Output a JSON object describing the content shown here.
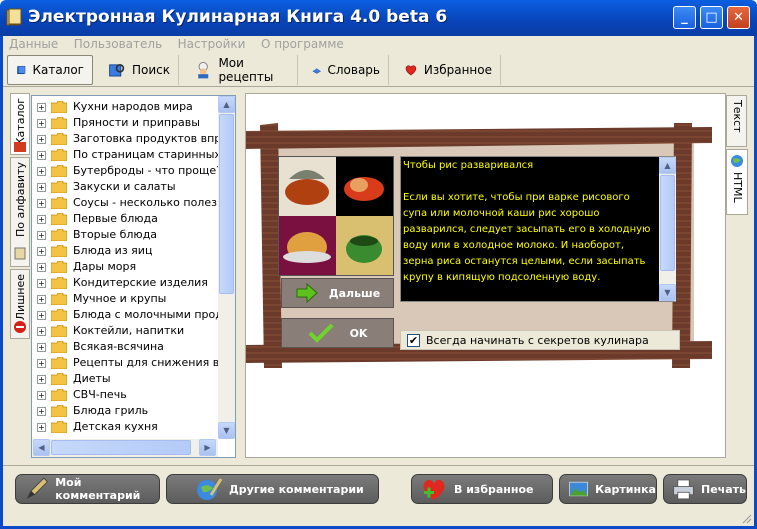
{
  "window": {
    "title": "Электронная Кулинарная Книга 4.0 beta 6",
    "minimize": "_",
    "maximize": "□",
    "close": "✕"
  },
  "menu": [
    "Данные",
    "Пользователь",
    "Настройки",
    "О программе"
  ],
  "toolbar": {
    "catalog": "Каталог",
    "search": "Поиск",
    "my_recipes": "Мои рецепты",
    "dictionary": "Словарь",
    "favorites": "Избранное"
  },
  "left_tabs": {
    "catalog": "Каталог",
    "alphabet": "По алфавиту",
    "extra": "Лишнее"
  },
  "tree_items": [
    "Кухни народов мира",
    "Пряности и приправы",
    "Заготовка продуктов впрок",
    "По страницам старинных ку",
    "Бутерброды - что проще?",
    "Закуски и салаты",
    "Соусы - несколько полезны",
    "Первые блюда",
    "Вторые блюда",
    "Блюда из яиц",
    "Дары моря",
    "Кондитерские изделия",
    "Мучное и крупы",
    "Блюда с молочными продукт",
    "Коктейли, напитки",
    "Всякая-всячина",
    "Рецепты для снижения веса",
    "Диеты",
    "СВЧ-печь",
    "Блюда гриль",
    "Детская кухня"
  ],
  "right_tabs": {
    "text": "Текст",
    "html": "HTML"
  },
  "tips": {
    "title": "Чтобы рис разваривался",
    "body": "Если вы хотите, чтобы при варке рисового супа или молочной каши рис хорошо разварился, следует засыпать его в холодную воду или в холодное молоко. И наоборот, зерна  риса останутся целыми, если засыпать крупу в кипящую подсоленную воду."
  },
  "dialog": {
    "next_label": "Дальше",
    "ok_label": "OK",
    "always_label": "Всегда начинать с секретов кулинара",
    "always_checked": true
  },
  "bottom": {
    "my_comment": "Мой комментарий",
    "other_comments": "Другие комментарии",
    "to_favorites": "В избранное",
    "picture": "Картинка",
    "print": "Печать"
  },
  "colors": {
    "title_bar": "#0a5fe0",
    "frame_wood": "#6b3a2a",
    "tips_text": "#ffff00",
    "tips_bg": "#000000"
  }
}
